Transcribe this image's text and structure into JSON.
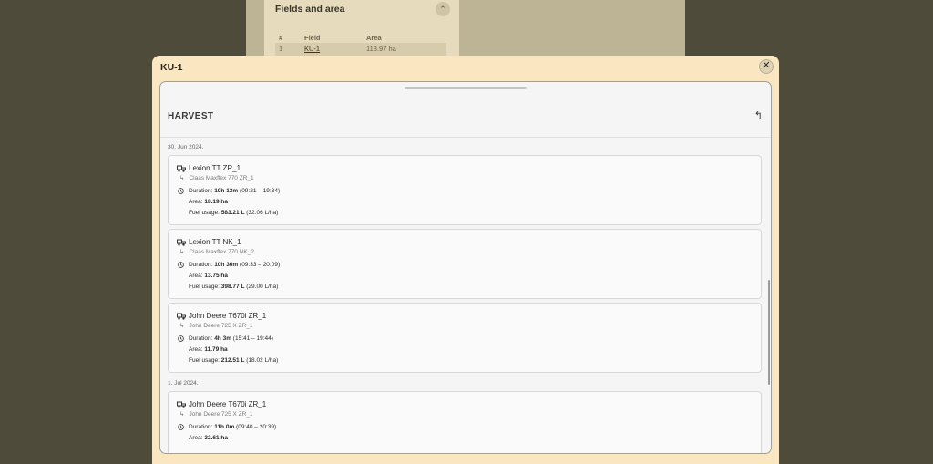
{
  "background": {
    "section_title": "Fields and area",
    "table_headers": [
      "#",
      "Field",
      "Area"
    ],
    "row": {
      "index": "1",
      "field": "KU-1",
      "area": "113.97 ha"
    }
  },
  "modal": {
    "title": "KU-1",
    "close_label": "✕",
    "panel_title": "HARVEST",
    "back_label": "↰"
  },
  "groups": [
    {
      "date": "30. Jun 2024.",
      "entries": [
        {
          "machine": "Lexion TT ZR_1",
          "implement": "Claas Maxflex 770 ZR_1",
          "duration_label": "Duration:",
          "duration": "10h 13m",
          "time_range": "(09:21 – 19:34)",
          "area_label": "Area:",
          "area": "18.19 ha",
          "fuel_label": "Fuel usage:",
          "fuel": "583.21 L",
          "fuel_rate": "(32.06 L/ha)"
        },
        {
          "machine": "Lexion TT NK_1",
          "implement": "Claas Maxflex 770 NK_2",
          "duration_label": "Duration:",
          "duration": "10h 36m",
          "time_range": "(09:33 – 20:09)",
          "area_label": "Area:",
          "area": "13.75 ha",
          "fuel_label": "Fuel usage:",
          "fuel": "398.77 L",
          "fuel_rate": "(29.00 L/ha)"
        },
        {
          "machine": "John Deere T670i ZR_1",
          "implement": "John Deere 725 X ZR_1",
          "duration_label": "Duration:",
          "duration": "4h 3m",
          "time_range": "(15:41 – 19:44)",
          "area_label": "Area:",
          "area": "11.79 ha",
          "fuel_label": "Fuel usage:",
          "fuel": "212.51 L",
          "fuel_rate": "(18.02 L/ha)"
        }
      ]
    },
    {
      "date": "1. Jul 2024.",
      "entries": [
        {
          "machine": "John Deere T670i ZR_1",
          "implement": "John Deere 725 X ZR_1",
          "duration_label": "Duration:",
          "duration": "11h 0m",
          "time_range": "(09:40 – 20:39)",
          "area_label": "Area:",
          "area": "32.61 ha",
          "fuel_label": "",
          "fuel": "",
          "fuel_rate": ""
        }
      ]
    }
  ],
  "implement_arrow": "↳",
  "colors": {
    "modal_bg": "#fbe6c2",
    "panel_bg": "#f5f5f5",
    "overlay": "#4f4b3a"
  }
}
